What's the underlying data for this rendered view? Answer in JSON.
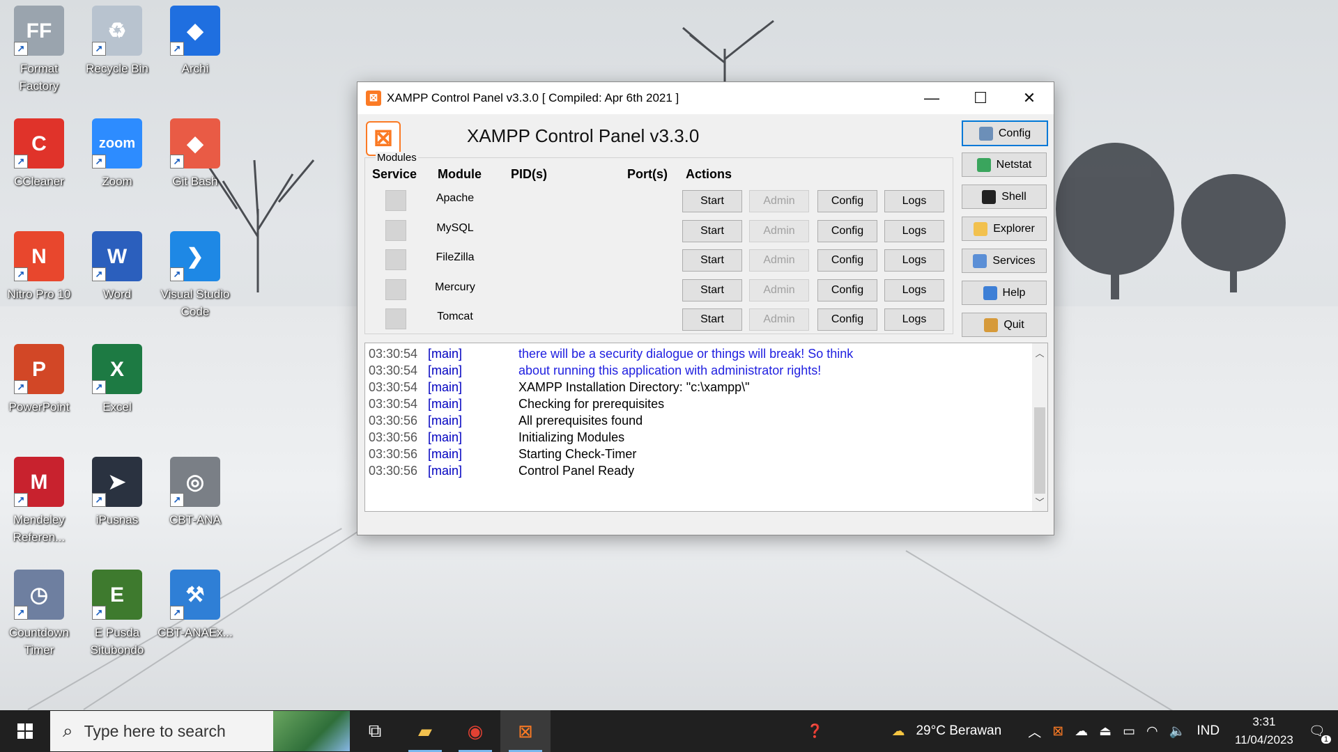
{
  "desktop": {
    "icons": [
      {
        "label": "Format\nFactory",
        "glyph": "FF",
        "color": "#9aa4ae"
      },
      {
        "label": "Recycle Bin",
        "glyph": "♻",
        "color": "#b8c3cf"
      },
      {
        "label": "Archi",
        "glyph": "◆",
        "color": "#1f6fe0"
      },
      {
        "label": "CCleaner",
        "glyph": "C",
        "color": "#e0332a"
      },
      {
        "label": "Zoom",
        "glyph": "zoom",
        "color": "#2d8cff"
      },
      {
        "label": "Git Bash",
        "glyph": "◆",
        "color": "#e95b45"
      },
      {
        "label": "Nitro Pro 10",
        "glyph": "N",
        "color": "#e8472d"
      },
      {
        "label": "Word",
        "glyph": "W",
        "color": "#2b5fbd"
      },
      {
        "label": "Visual Studio\nCode",
        "glyph": "❯",
        "color": "#1e88e5"
      },
      {
        "label": "PowerPoint",
        "glyph": "P",
        "color": "#d24726"
      },
      {
        "label": "Excel",
        "glyph": "X",
        "color": "#1d7a43"
      },
      {
        "label": "Mendeley\nReferen...",
        "glyph": "M",
        "color": "#c8222e"
      },
      {
        "label": "iPusnas",
        "glyph": "➤",
        "color": "#2a3240"
      },
      {
        "label": "CBT-ANA",
        "glyph": "◎",
        "color": "#7a7f86"
      },
      {
        "label": "Countdown\nTimer",
        "glyph": "◷",
        "color": "#6e7fa0"
      },
      {
        "label": "E Pusda\nSitubondo",
        "glyph": "E",
        "color": "#3e7a2e"
      },
      {
        "label": "CBT-ANAEx...",
        "glyph": "⚒",
        "color": "#2f7fd6"
      }
    ]
  },
  "window": {
    "title": "XAMPP Control Panel v3.3.0   [ Compiled: Apr 6th 2021 ]",
    "app_icon": "xampp-icon",
    "controls": {
      "minimize": "—",
      "maximize": "☐",
      "close": "✕"
    },
    "header_title": "XAMPP Control Panel v3.3.0",
    "modules_legend": "Modules",
    "columns": {
      "service": "Service",
      "module": "Module",
      "pids": "PID(s)",
      "ports": "Port(s)",
      "actions": "Actions"
    },
    "modules": [
      {
        "name": "Apache",
        "start": "Start",
        "admin": "Admin",
        "config": "Config",
        "logs": "Logs"
      },
      {
        "name": "MySQL",
        "start": "Start",
        "admin": "Admin",
        "config": "Config",
        "logs": "Logs"
      },
      {
        "name": "FileZilla",
        "start": "Start",
        "admin": "Admin",
        "config": "Config",
        "logs": "Logs"
      },
      {
        "name": "Mercury",
        "start": "Start",
        "admin": "Admin",
        "config": "Config",
        "logs": "Logs"
      },
      {
        "name": "Tomcat",
        "start": "Start",
        "admin": "Admin",
        "config": "Config",
        "logs": "Logs"
      }
    ],
    "side_buttons": [
      {
        "label": "Config",
        "icon": "wrench-icon",
        "color": "#6c8fb8"
      },
      {
        "label": "Netstat",
        "icon": "globe-icon",
        "color": "#3aa55d"
      },
      {
        "label": "Shell",
        "icon": "terminal-icon",
        "color": "#222"
      },
      {
        "label": "Explorer",
        "icon": "folder-icon",
        "color": "#f2c14e"
      },
      {
        "label": "Services",
        "icon": "services-icon",
        "color": "#5b8fd6"
      },
      {
        "label": "Help",
        "icon": "help-icon",
        "color": "#3d7fd6"
      },
      {
        "label": "Quit",
        "icon": "door-icon",
        "color": "#d69a3a"
      }
    ],
    "log": [
      {
        "time": "03:30:54",
        "src": "[main]",
        "msg": "there will be a security dialogue or things will break! So think",
        "highlight": true
      },
      {
        "time": "03:30:54",
        "src": "[main]",
        "msg": "about running this application with administrator rights!",
        "highlight": true
      },
      {
        "time": "03:30:54",
        "src": "[main]",
        "msg": "XAMPP Installation Directory: \"c:\\xampp\\\"",
        "highlight": false
      },
      {
        "time": "03:30:54",
        "src": "[main]",
        "msg": "Checking for prerequisites",
        "highlight": false
      },
      {
        "time": "03:30:56",
        "src": "[main]",
        "msg": "All prerequisites found",
        "highlight": false
      },
      {
        "time": "03:30:56",
        "src": "[main]",
        "msg": "Initializing Modules",
        "highlight": false
      },
      {
        "time": "03:30:56",
        "src": "[main]",
        "msg": "Starting Check-Timer",
        "highlight": false
      },
      {
        "time": "03:30:56",
        "src": "[main]",
        "msg": "Control Panel Ready",
        "highlight": false
      }
    ]
  },
  "taskbar": {
    "search_placeholder": "Type here to search",
    "weather": "29°C  Berawan",
    "language": "IND",
    "time": "3:31",
    "date": "11/04/2023",
    "notification_count": "1"
  }
}
